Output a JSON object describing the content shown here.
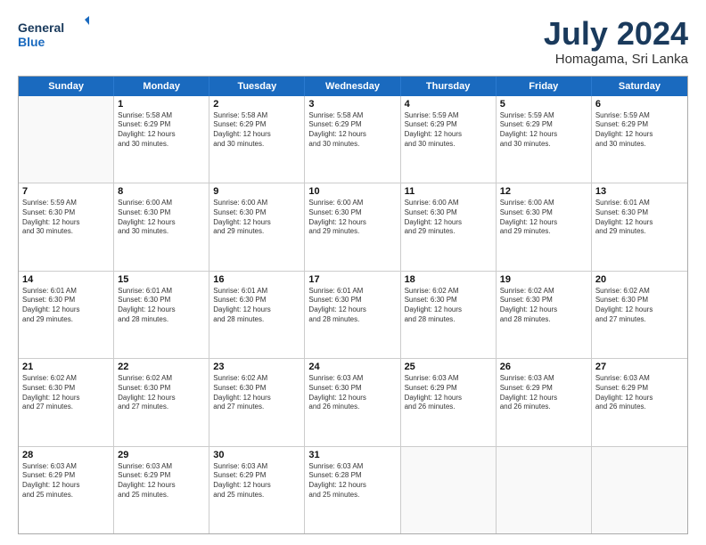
{
  "logo": {
    "line1": "General",
    "line2": "Blue"
  },
  "title": "July 2024",
  "subtitle": "Homagama, Sri Lanka",
  "header_days": [
    "Sunday",
    "Monday",
    "Tuesday",
    "Wednesday",
    "Thursday",
    "Friday",
    "Saturday"
  ],
  "weeks": [
    [
      {
        "day": "",
        "info": ""
      },
      {
        "day": "1",
        "info": "Sunrise: 5:58 AM\nSunset: 6:29 PM\nDaylight: 12 hours\nand 30 minutes."
      },
      {
        "day": "2",
        "info": "Sunrise: 5:58 AM\nSunset: 6:29 PM\nDaylight: 12 hours\nand 30 minutes."
      },
      {
        "day": "3",
        "info": "Sunrise: 5:58 AM\nSunset: 6:29 PM\nDaylight: 12 hours\nand 30 minutes."
      },
      {
        "day": "4",
        "info": "Sunrise: 5:59 AM\nSunset: 6:29 PM\nDaylight: 12 hours\nand 30 minutes."
      },
      {
        "day": "5",
        "info": "Sunrise: 5:59 AM\nSunset: 6:29 PM\nDaylight: 12 hours\nand 30 minutes."
      },
      {
        "day": "6",
        "info": "Sunrise: 5:59 AM\nSunset: 6:29 PM\nDaylight: 12 hours\nand 30 minutes."
      }
    ],
    [
      {
        "day": "7",
        "info": "Sunrise: 5:59 AM\nSunset: 6:30 PM\nDaylight: 12 hours\nand 30 minutes."
      },
      {
        "day": "8",
        "info": "Sunrise: 6:00 AM\nSunset: 6:30 PM\nDaylight: 12 hours\nand 30 minutes."
      },
      {
        "day": "9",
        "info": "Sunrise: 6:00 AM\nSunset: 6:30 PM\nDaylight: 12 hours\nand 29 minutes."
      },
      {
        "day": "10",
        "info": "Sunrise: 6:00 AM\nSunset: 6:30 PM\nDaylight: 12 hours\nand 29 minutes."
      },
      {
        "day": "11",
        "info": "Sunrise: 6:00 AM\nSunset: 6:30 PM\nDaylight: 12 hours\nand 29 minutes."
      },
      {
        "day": "12",
        "info": "Sunrise: 6:00 AM\nSunset: 6:30 PM\nDaylight: 12 hours\nand 29 minutes."
      },
      {
        "day": "13",
        "info": "Sunrise: 6:01 AM\nSunset: 6:30 PM\nDaylight: 12 hours\nand 29 minutes."
      }
    ],
    [
      {
        "day": "14",
        "info": "Sunrise: 6:01 AM\nSunset: 6:30 PM\nDaylight: 12 hours\nand 29 minutes."
      },
      {
        "day": "15",
        "info": "Sunrise: 6:01 AM\nSunset: 6:30 PM\nDaylight: 12 hours\nand 28 minutes."
      },
      {
        "day": "16",
        "info": "Sunrise: 6:01 AM\nSunset: 6:30 PM\nDaylight: 12 hours\nand 28 minutes."
      },
      {
        "day": "17",
        "info": "Sunrise: 6:01 AM\nSunset: 6:30 PM\nDaylight: 12 hours\nand 28 minutes."
      },
      {
        "day": "18",
        "info": "Sunrise: 6:02 AM\nSunset: 6:30 PM\nDaylight: 12 hours\nand 28 minutes."
      },
      {
        "day": "19",
        "info": "Sunrise: 6:02 AM\nSunset: 6:30 PM\nDaylight: 12 hours\nand 28 minutes."
      },
      {
        "day": "20",
        "info": "Sunrise: 6:02 AM\nSunset: 6:30 PM\nDaylight: 12 hours\nand 27 minutes."
      }
    ],
    [
      {
        "day": "21",
        "info": "Sunrise: 6:02 AM\nSunset: 6:30 PM\nDaylight: 12 hours\nand 27 minutes."
      },
      {
        "day": "22",
        "info": "Sunrise: 6:02 AM\nSunset: 6:30 PM\nDaylight: 12 hours\nand 27 minutes."
      },
      {
        "day": "23",
        "info": "Sunrise: 6:02 AM\nSunset: 6:30 PM\nDaylight: 12 hours\nand 27 minutes."
      },
      {
        "day": "24",
        "info": "Sunrise: 6:03 AM\nSunset: 6:30 PM\nDaylight: 12 hours\nand 26 minutes."
      },
      {
        "day": "25",
        "info": "Sunrise: 6:03 AM\nSunset: 6:29 PM\nDaylight: 12 hours\nand 26 minutes."
      },
      {
        "day": "26",
        "info": "Sunrise: 6:03 AM\nSunset: 6:29 PM\nDaylight: 12 hours\nand 26 minutes."
      },
      {
        "day": "27",
        "info": "Sunrise: 6:03 AM\nSunset: 6:29 PM\nDaylight: 12 hours\nand 26 minutes."
      }
    ],
    [
      {
        "day": "28",
        "info": "Sunrise: 6:03 AM\nSunset: 6:29 PM\nDaylight: 12 hours\nand 25 minutes."
      },
      {
        "day": "29",
        "info": "Sunrise: 6:03 AM\nSunset: 6:29 PM\nDaylight: 12 hours\nand 25 minutes."
      },
      {
        "day": "30",
        "info": "Sunrise: 6:03 AM\nSunset: 6:29 PM\nDaylight: 12 hours\nand 25 minutes."
      },
      {
        "day": "31",
        "info": "Sunrise: 6:03 AM\nSunset: 6:28 PM\nDaylight: 12 hours\nand 25 minutes."
      },
      {
        "day": "",
        "info": ""
      },
      {
        "day": "",
        "info": ""
      },
      {
        "day": "",
        "info": ""
      }
    ]
  ]
}
